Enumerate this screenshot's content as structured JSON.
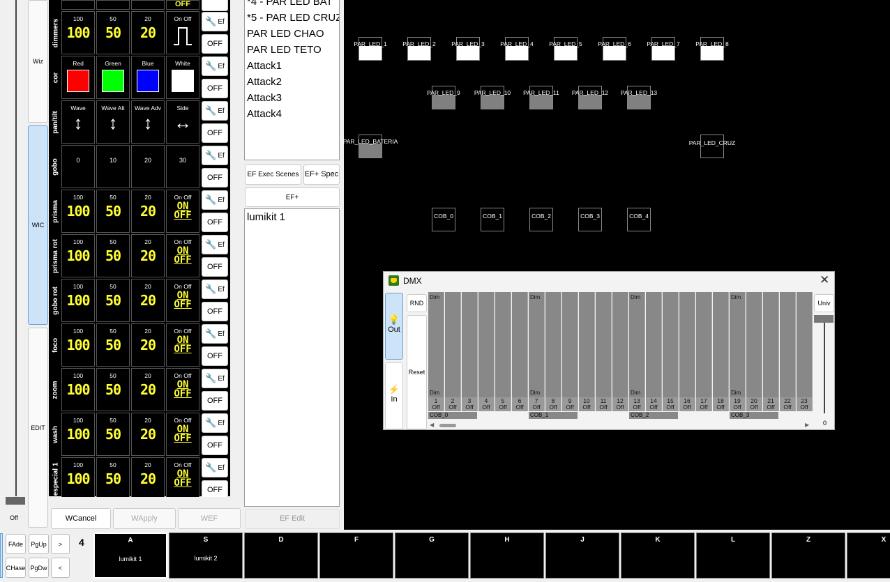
{
  "sidebar": {
    "tabs": [
      "Wiz",
      "WIC",
      "EDIT"
    ],
    "off_label": "Off"
  },
  "grid": {
    "rows": [
      {
        "label": "dimmers",
        "kind": "num-simple",
        "cells": [
          {
            "cap": "100",
            "val": "100"
          },
          {
            "cap": "50",
            "val": "50"
          },
          {
            "cap": "20",
            "val": "20"
          },
          {
            "cap": "On Off",
            "val": "pulse"
          }
        ]
      },
      {
        "label": "cor",
        "kind": "color",
        "cells": [
          {
            "cap": "Red",
            "color": "#ff0000"
          },
          {
            "cap": "Green",
            "color": "#00ff00"
          },
          {
            "cap": "Blue",
            "color": "#0000ff"
          },
          {
            "cap": "White",
            "color": "#ffffff"
          }
        ]
      },
      {
        "label": "pan/tilt",
        "kind": "arrows",
        "cells": [
          {
            "cap": "Wave",
            "glyph": "↕"
          },
          {
            "cap": "Wave Alt",
            "glyph": "↕"
          },
          {
            "cap": "Wave Adv",
            "glyph": "↕"
          },
          {
            "cap": "Side",
            "glyph": "↔"
          }
        ]
      },
      {
        "label": "gobo",
        "kind": "plain",
        "cells": [
          {
            "val": "0"
          },
          {
            "val": "10"
          },
          {
            "val": "20"
          },
          {
            "val": "30"
          }
        ]
      },
      {
        "label": "prisma",
        "kind": "num",
        "cells": [
          {
            "cap": "100",
            "val": "100"
          },
          {
            "cap": "50",
            "val": "50"
          },
          {
            "cap": "20",
            "val": "20"
          },
          {
            "cap": "On Off",
            "on": "ON",
            "off": "OFF"
          }
        ]
      },
      {
        "label": "prisma rot",
        "kind": "num",
        "cells": [
          {
            "cap": "100",
            "val": "100"
          },
          {
            "cap": "50",
            "val": "50"
          },
          {
            "cap": "20",
            "val": "20"
          },
          {
            "cap": "On Off",
            "on": "ON",
            "off": "OFF"
          }
        ]
      },
      {
        "label": "gobo rot",
        "kind": "num",
        "cells": [
          {
            "cap": "100",
            "val": "100"
          },
          {
            "cap": "50",
            "val": "50"
          },
          {
            "cap": "20",
            "val": "20"
          },
          {
            "cap": "On Off",
            "on": "ON",
            "off": "OFF"
          }
        ]
      },
      {
        "label": "foco",
        "kind": "num",
        "cells": [
          {
            "cap": "100",
            "val": "100"
          },
          {
            "cap": "50",
            "val": "50"
          },
          {
            "cap": "20",
            "val": "20"
          },
          {
            "cap": "On Off",
            "on": "ON",
            "off": "OFF"
          }
        ]
      },
      {
        "label": "zoom",
        "kind": "num",
        "cells": [
          {
            "cap": "100",
            "val": "100"
          },
          {
            "cap": "50",
            "val": "50"
          },
          {
            "cap": "20",
            "val": "20"
          },
          {
            "cap": "On Off",
            "on": "ON",
            "off": "OFF"
          }
        ]
      },
      {
        "label": "wash",
        "kind": "num",
        "cells": [
          {
            "cap": "100",
            "val": "100"
          },
          {
            "cap": "50",
            "val": "50"
          },
          {
            "cap": "20",
            "val": "20"
          },
          {
            "cap": "On Off",
            "on": "ON",
            "off": "OFF"
          }
        ]
      },
      {
        "label": "especial 1",
        "kind": "num",
        "cells": [
          {
            "cap": "100",
            "val": "100"
          },
          {
            "cap": "50",
            "val": "50"
          },
          {
            "cap": "20",
            "val": "20"
          },
          {
            "cap": "On Off",
            "on": "ON",
            "off": "OFF"
          }
        ]
      }
    ],
    "ef_label": "Ef",
    "off_label": "OFF",
    "top_partial_cell": "OFF"
  },
  "wizard_buttons": {
    "cancel": "WCancel",
    "apply": "WApply",
    "ef": "WEF"
  },
  "fixture_list": [
    "*4 - PAR LED BAT",
    "*5 - PAR LED CRUZ",
    "PAR LED CHAO",
    "PAR LED TETO",
    "Attack1",
    "Attack2",
    "Attack3",
    "Attack4"
  ],
  "ef_buttons": {
    "exec": "EF Exec Scenes",
    "spec": "EF+ Spec",
    "plus": "EF+",
    "edit": "EF Edit"
  },
  "ef_list": [
    "lumikit 1"
  ],
  "stage": {
    "fixtures": [
      {
        "name": "PAR_LED_1",
        "fill": "#ffffff"
      },
      {
        "name": "PAR_LED_2",
        "fill": "#ffffff"
      },
      {
        "name": "PAR_LED_3",
        "fill": "#ffffff"
      },
      {
        "name": "PAR_LED_4",
        "fill": "#ffffff"
      },
      {
        "name": "PAR_LED_5",
        "fill": "#ffffff"
      },
      {
        "name": "PAR_LED_6",
        "fill": "#ffffff"
      },
      {
        "name": "PAR_LED_7",
        "fill": "#ffffff"
      },
      {
        "name": "PAR_LED_8",
        "fill": "#ffffff"
      },
      {
        "name": "PAR_LED_9",
        "fill": "#808080"
      },
      {
        "name": "PAR_LED_10",
        "fill": "#808080"
      },
      {
        "name": "PAR_LED_11",
        "fill": "#808080"
      },
      {
        "name": "PAR_LED_12",
        "fill": "#808080"
      },
      {
        "name": "PAR_LED_13",
        "fill": "#808080"
      },
      {
        "name": "PAR_LED_BATERIA",
        "fill": "#808080"
      },
      {
        "name": "PAR_LED_CRUZ",
        "fill": "#000000"
      },
      {
        "name": "COB_0",
        "fill": "#000000"
      },
      {
        "name": "COB_1",
        "fill": "#000000"
      },
      {
        "name": "COB_2",
        "fill": "#000000"
      },
      {
        "name": "COB_3",
        "fill": "#000000"
      },
      {
        "name": "COB_4",
        "fill": "#000000"
      }
    ]
  },
  "dmx": {
    "title": "DMX",
    "out_label": "Out",
    "in_label": "In",
    "rnd_label": "RND",
    "reset_label": "Reset",
    "univ_label": "Univ",
    "univ_value": "0",
    "dim_label": "Dim",
    "off_label": "Off",
    "channels": [
      "1",
      "2",
      "3",
      "4",
      "5",
      "6",
      "7",
      "8",
      "9",
      "10",
      "11",
      "12",
      "13",
      "14",
      "15",
      "16",
      "17",
      "18",
      "19",
      "20",
      "21",
      "22",
      "23"
    ],
    "groups": [
      "COB_0",
      "COB_1",
      "COB_2",
      "COB_3"
    ]
  },
  "bottom": {
    "fade": "FAde",
    "chase": "CHase",
    "pgup": "PgUp",
    "pgdw": "PgDw",
    "next": ">",
    "prev": "<",
    "page": "4",
    "scenes": [
      {
        "key": "A",
        "name": "lumikit 1"
      },
      {
        "key": "S",
        "name": "lumikit 2"
      },
      {
        "key": "D",
        "name": ""
      },
      {
        "key": "F",
        "name": ""
      },
      {
        "key": "G",
        "name": ""
      },
      {
        "key": "H",
        "name": ""
      },
      {
        "key": "J",
        "name": ""
      },
      {
        "key": "K",
        "name": ""
      },
      {
        "key": "L",
        "name": ""
      },
      {
        "key": "Z",
        "name": ""
      },
      {
        "key": "X",
        "name": ""
      }
    ]
  }
}
